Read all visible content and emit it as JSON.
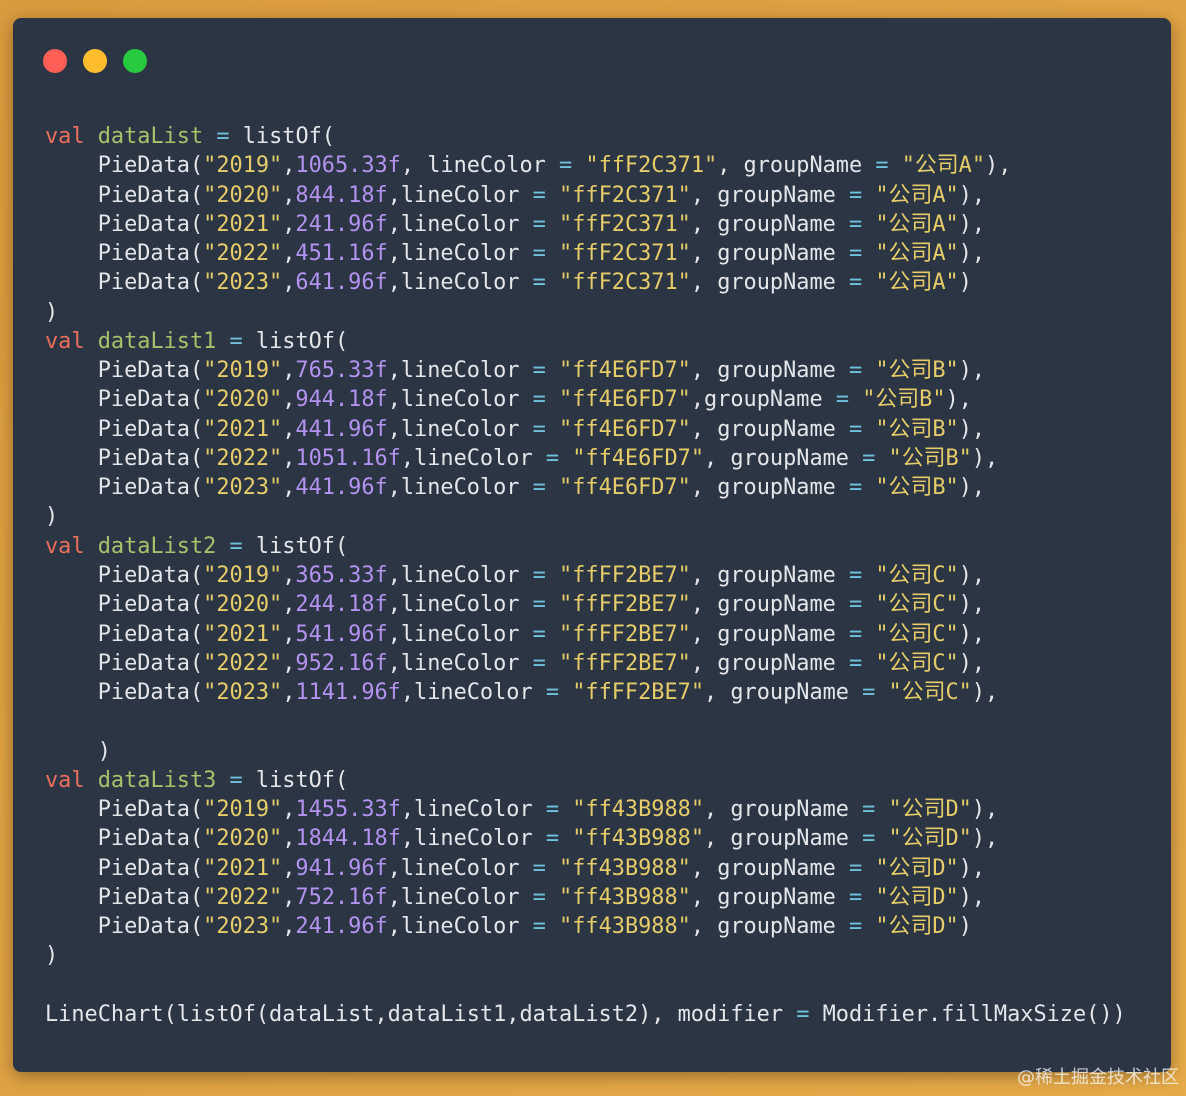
{
  "page": {
    "background_color_start": "#DA9A3E",
    "background_color_end": "#E6AA48"
  },
  "window": {
    "background_color": "#2B3543",
    "controls": {
      "close_color": "#FF5F56",
      "minimize_color": "#FFBD2E",
      "maximize_color": "#27C93F"
    }
  },
  "syntax_colors": {
    "text": "#E4E6EA",
    "keyword": "#EC6F5C",
    "declaration": "#A4C46C",
    "operator": "#6FC3DF",
    "string": "#E6CD69",
    "number": "#B392F0"
  },
  "code": {
    "lines": [
      "val dataList = listOf(",
      "    PieData(\"2019\",1065.33f, lineColor = \"ffF2C371\", groupName = \"公司A\"),",
      "    PieData(\"2020\",844.18f,lineColor = \"ffF2C371\", groupName = \"公司A\"),",
      "    PieData(\"2021\",241.96f,lineColor = \"ffF2C371\", groupName = \"公司A\"),",
      "    PieData(\"2022\",451.16f,lineColor = \"ffF2C371\", groupName = \"公司A\"),",
      "    PieData(\"2023\",641.96f,lineColor = \"ffF2C371\", groupName = \"公司A\")",
      ")",
      "val dataList1 = listOf(",
      "    PieData(\"2019\",765.33f,lineColor = \"ff4E6FD7\", groupName = \"公司B\"),",
      "    PieData(\"2020\",944.18f,lineColor = \"ff4E6FD7\",groupName = \"公司B\"),",
      "    PieData(\"2021\",441.96f,lineColor = \"ff4E6FD7\", groupName = \"公司B\"),",
      "    PieData(\"2022\",1051.16f,lineColor = \"ff4E6FD7\", groupName = \"公司B\"),",
      "    PieData(\"2023\",441.96f,lineColor = \"ff4E6FD7\", groupName = \"公司B\"),",
      ")",
      "val dataList2 = listOf(",
      "    PieData(\"2019\",365.33f,lineColor = \"ffFF2BE7\", groupName = \"公司C\"),",
      "    PieData(\"2020\",244.18f,lineColor = \"ffFF2BE7\", groupName = \"公司C\"),",
      "    PieData(\"2021\",541.96f,lineColor = \"ffFF2BE7\", groupName = \"公司C\"),",
      "    PieData(\"2022\",952.16f,lineColor = \"ffFF2BE7\", groupName = \"公司C\"),",
      "    PieData(\"2023\",1141.96f,lineColor = \"ffFF2BE7\", groupName = \"公司C\"),",
      "",
      "    )",
      "val dataList3 = listOf(",
      "    PieData(\"2019\",1455.33f,lineColor = \"ff43B988\", groupName = \"公司D\"),",
      "    PieData(\"2020\",1844.18f,lineColor = \"ff43B988\", groupName = \"公司D\"),",
      "    PieData(\"2021\",941.96f,lineColor = \"ff43B988\", groupName = \"公司D\"),",
      "    PieData(\"2022\",752.16f,lineColor = \"ff43B988\", groupName = \"公司D\"),",
      "    PieData(\"2023\",241.96f,lineColor = \"ff43B988\", groupName = \"公司D\")",
      ")",
      "",
      "LineChart(listOf(dataList,dataList1,dataList2), modifier = Modifier.fillMaxSize())"
    ]
  },
  "watermark": "@稀土掘金技术社区"
}
